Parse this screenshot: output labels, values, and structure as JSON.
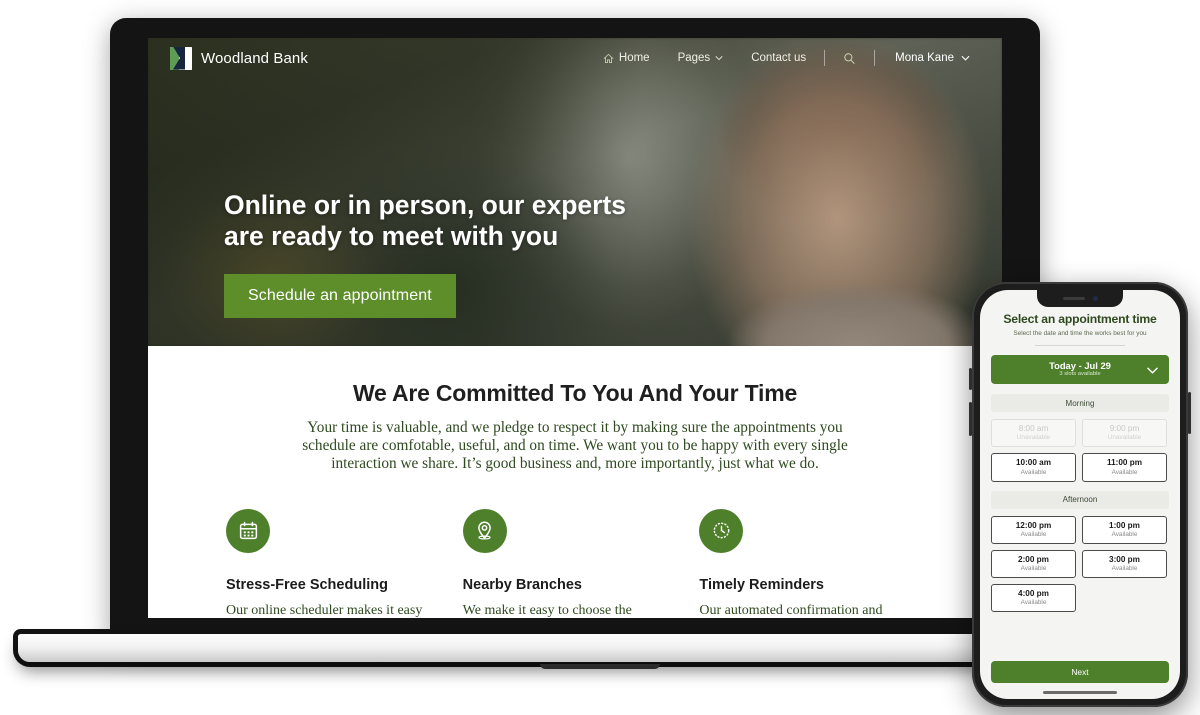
{
  "brand": {
    "name": "Woodland Bank",
    "logo_icon": "woodland-logo-mark"
  },
  "nav": {
    "home": "Home",
    "pages": "Pages",
    "contact": "Contact us",
    "search_icon": "search-icon",
    "user": "Mona Kane",
    "chevron_icon": "chevron-down-icon",
    "home_icon": "home-icon"
  },
  "hero": {
    "heading_line1": "Online or in person, our experts",
    "heading_line2": "are ready to meet with you",
    "cta": "Schedule an appointment",
    "cta_color": "#5d8e2a"
  },
  "committed": {
    "title": "We Are Committed To You And Your Time",
    "body": "Your time is valuable, and we pledge to respect it by making sure the appointments you schedule are comfotable, useful, and on time. We want you to be happy with every single interaction we share. It’s good business and, more importantly, just what we do.",
    "text_color": "#2f4a20"
  },
  "features": [
    {
      "icon": "calendar-icon",
      "title": "Stress-Free Scheduling",
      "body": "Our online scheduler makes it easy to get the meeting time"
    },
    {
      "icon": "map-pin-icon",
      "title": "Nearby Branches",
      "body": "We make it easy to choose the location to meet that is"
    },
    {
      "icon": "clock-icon",
      "title": "Timely Reminders",
      "body": "Our automated confirmation and reminder messages helps"
    }
  ],
  "phone_app": {
    "title": "Select an appointment time",
    "subtitle": "Select the date and time the works best for you",
    "date_picker": {
      "label": "Today - Jul 29",
      "sub": "3 slots available",
      "chevron_icon": "chevron-down-icon",
      "color": "#4e7f2b"
    },
    "sections": [
      {
        "heading": "Morning",
        "slots": [
          {
            "time": "8:00 am",
            "state": "Unavailable",
            "available": false
          },
          {
            "time": "9:00 pm",
            "state": "Unavailable",
            "available": false
          },
          {
            "time": "10:00 am",
            "state": "Available",
            "available": true
          },
          {
            "time": "11:00 pm",
            "state": "Available",
            "available": true
          }
        ]
      },
      {
        "heading": "Afternoon",
        "slots": [
          {
            "time": "12:00 pm",
            "state": "Available",
            "available": true
          },
          {
            "time": "1:00 pm",
            "state": "Available",
            "available": true
          },
          {
            "time": "2:00 pm",
            "state": "Available",
            "available": true
          },
          {
            "time": "3:00 pm",
            "state": "Available",
            "available": true
          },
          {
            "time": "4:00 pm",
            "state": "Available",
            "available": true
          }
        ]
      }
    ],
    "next_label": "Next"
  }
}
